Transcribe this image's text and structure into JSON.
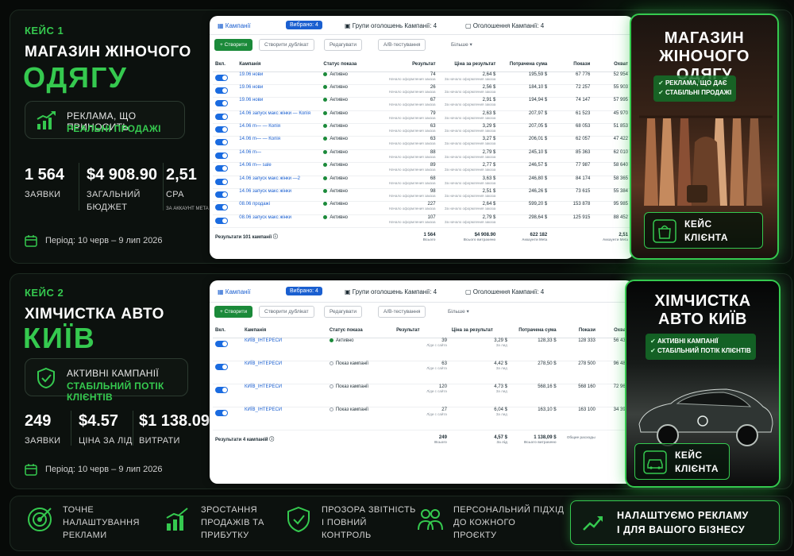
{
  "colors": {
    "accent": "#35c94f",
    "link": "#1a5fd0",
    "background": "#070a08"
  },
  "case1": {
    "label": "КЕЙС 1",
    "title": "МАГАЗИН ЖІНОЧОГО",
    "big": "ОДЯГУ",
    "pill_line1": "РЕКЛАМА, ЩО ПРИНОСИТЬ",
    "pill_line2": "РЕАЛЬНІ ПРОДАЖІ",
    "stats": [
      {
        "value": "1 564",
        "label": "ЗАЯВКИ"
      },
      {
        "value": "$4 908.90",
        "label": "ЗАГАЛЬНИЙ БЮДЖЕТ"
      },
      {
        "value": "2,51",
        "label": "CPA",
        "sub": "ЗА АККАУНТ META"
      }
    ],
    "period": "Період: 10 черв – 9 лип 2026"
  },
  "case2": {
    "label": "КЕЙС 2",
    "title": "ХІМЧИСТКА АВТО",
    "big": "КИЇВ",
    "pill_line1": "АКТИВНІ КАМПАНІЇ",
    "pill_line2": "СТАБІЛЬНИЙ ПОТІК КЛІЄНТІВ",
    "stats": [
      {
        "value": "249",
        "label": "ЗАЯВКИ"
      },
      {
        "value": "$4.57",
        "label": "ЦІНА ЗА ЛІД"
      },
      {
        "value": "$1 138.09",
        "label": "ВИТРАТИ"
      }
    ],
    "period": "Період: 10 черв – 9 лип 2026"
  },
  "table1": {
    "tab_campaigns": "Кампанії",
    "selected": "Вибрано: 4",
    "tab_adsets": "Групи оголошень Кампанії: 4",
    "tab_ads": "Оголошення Кампанії: 4",
    "btn_create": "+ Створити",
    "btn_duplicate": "Створити дублікат",
    "btn_edit": "Редагувати",
    "btn_ab": "A/B-тестування",
    "btn_more": "Більше",
    "headers": [
      "Вкл.",
      "Кампанія",
      "Статус показа",
      "Результат",
      "Ціна за результат",
      "Потрачена сума",
      "Покази",
      "Охват"
    ],
    "result_sub": "Начало оформления заказа",
    "cost_sub": "За начало оформления заказа",
    "rows": [
      {
        "name": "19.06 нови",
        "status": "Активно",
        "result": "74",
        "cost": "2,64 $",
        "spent": "195,59 $",
        "impr": "67 776",
        "reach": "52 954"
      },
      {
        "name": "19.06 нови",
        "status": "Активно",
        "result": "26",
        "cost": "2,56 $",
        "spent": "184,10 $",
        "impr": "72 257",
        "reach": "55 903"
      },
      {
        "name": "19.06 нови",
        "status": "Активно",
        "result": "67",
        "cost": "2,91 $",
        "spent": "194,94 $",
        "impr": "74 147",
        "reach": "57 995"
      },
      {
        "name": "14.06 запуск макс жінки — Копія",
        "status": "Активно",
        "result": "79",
        "cost": "2,63 $",
        "spent": "207,97 $",
        "impr": "61 523",
        "reach": "45 970"
      },
      {
        "name": "14.06 m— — Копія",
        "status": "Активно",
        "result": "63",
        "cost": "3,29 $",
        "spent": "207,05 $",
        "impr": "68 053",
        "reach": "51 853"
      },
      {
        "name": "14.06 m— — Копія",
        "status": "Активно",
        "result": "63",
        "cost": "3,27 $",
        "spent": "206,01 $",
        "impr": "62 057",
        "reach": "47 422"
      },
      {
        "name": "14.06 m—",
        "status": "Активно",
        "result": "88",
        "cost": "2,79 $",
        "spent": "245,10 $",
        "impr": "85 363",
        "reach": "62 010"
      },
      {
        "name": "14.06 m— sale",
        "status": "Активно",
        "result": "89",
        "cost": "2,77 $",
        "spent": "246,57 $",
        "impr": "77 987",
        "reach": "58 640"
      },
      {
        "name": "14.06 запуск макс жінки —2",
        "status": "Активно",
        "result": "68",
        "cost": "3,63 $",
        "spent": "246,80 $",
        "impr": "84 174",
        "reach": "58 365"
      },
      {
        "name": "14.06 запуск макс жінки",
        "status": "Активно",
        "result": "98",
        "cost": "2,51 $",
        "spent": "246,26 $",
        "impr": "73 615",
        "reach": "55 384"
      },
      {
        "name": "08.06 продажі",
        "status": "Активно",
        "result": "227",
        "cost": "2,64 $",
        "spent": "599,20 $",
        "impr": "153 878",
        "reach": "95 985"
      },
      {
        "name": "08.06 запуск макс жінки",
        "status": "Активно",
        "result": "107",
        "cost": "2,79 $",
        "spent": "298,64 $",
        "impr": "125 915",
        "reach": "88 452"
      }
    ],
    "total": {
      "label": "Результати 101 кампанії",
      "result": "1 564",
      "result_sub": "Всього",
      "cost": "$4 908.90",
      "cost_sub": "Всього витрачено",
      "spent": "622 182",
      "spent_sub": "Аккаунти Meta",
      "cpa": "2,51",
      "cpa_sub": "Аккаунти Meta"
    }
  },
  "table2": {
    "tab_campaigns": "Кампанії",
    "selected": "Вибрано: 4",
    "tab_adsets": "Групи оголошень Кампанії: 4",
    "tab_ads": "Оголошення Кампанії: 4",
    "btn_create": "+ Створити",
    "btn_duplicate": "Створити дублікат",
    "btn_edit": "Редагувати",
    "btn_ab": "A/B-тестування",
    "btn_more": "Більше",
    "headers": [
      "Вкл.",
      "Кампанія",
      "Статус показа",
      "Результат",
      "Ціна за результат",
      "Потрачена сума",
      "Покази",
      "Охват"
    ],
    "result_sub": "Ліди с сайта",
    "cost_sub": "За лид",
    "rows": [
      {
        "name": "КИЇВ_ІНТЕРЕСИ",
        "status": "Активно",
        "active": true,
        "result": "39",
        "cost": "3,29 $",
        "spent": "128,33 $",
        "impr": "128 333",
        "reach": "56 437"
      },
      {
        "name": "КИЇВ_ІНТЕРЕСИ",
        "status": "Показ кампанії",
        "active": false,
        "result": "63",
        "cost": "4,42 $",
        "spent": "278,50 $",
        "impr": "278 500",
        "reach": "96 489"
      },
      {
        "name": "КИЇВ_ІНТЕРЕСИ",
        "status": "Показ кампанії",
        "active": false,
        "result": "120",
        "cost": "4,73 $",
        "spent": "568,16 $",
        "impr": "568 160",
        "reach": "72 960"
      },
      {
        "name": "КИЇВ_ІНТЕРЕСИ",
        "status": "Показ кампанії",
        "active": false,
        "result": "27",
        "cost": "6,04 $",
        "spent": "163,10 $",
        "impr": "163 100",
        "reach": "34 390"
      }
    ],
    "total": {
      "label": "Результати 4 кампаній",
      "result": "249",
      "result_sub": "Всього",
      "cost": "4,57 $",
      "cost_sub": "За лід",
      "spent": "1 138,09 $",
      "spent_sub": "Всього витрачено",
      "impr_sub": "Общие расходы"
    }
  },
  "promo1": {
    "title_l1": "МАГАЗИН",
    "title_l2": "ЖІНОЧОГО ОДЯГУ",
    "tick1": "РЕКЛАМА, ЩО ДАЄ",
    "tick2": "СТАБІЛЬНІ ПРОДАЖІ",
    "cta_l1": "КЕЙС",
    "cta_l2": "КЛІЄНТА"
  },
  "promo2": {
    "title_l1": "ХІМЧИСТКА",
    "title_l2": "АВТО КИЇВ",
    "tick1": "АКТИВНІ КАМПАНІЇ",
    "tick2": "СТАБІЛЬНИЙ ПОТІК КЛІЄНТІВ",
    "cta_l1": "КЕЙС",
    "cta_l2": "КЛІЄНТА"
  },
  "footer": {
    "f1": [
      "ТОЧНЕ",
      "НАЛАШТУВАННЯ",
      "РЕКЛАМИ"
    ],
    "f2": [
      "ЗРОСТАННЯ",
      "ПРОДАЖІВ ТА",
      "ПРИБУТКУ"
    ],
    "f3": [
      "ПРОЗОРА ЗВІТНІСТЬ",
      "І ПОВНИЙ",
      "КОНТРОЛЬ"
    ],
    "f4": [
      "ПЕРСОНАЛЬНИЙ ПІДХІД",
      "ДО КОЖНОГО",
      "ПРОЄКТУ"
    ],
    "cta_l1": "НАЛАШТУЄМО РЕКЛАМУ",
    "cta_l2": "І ДЛЯ ВАШОГО БІЗНЕСУ"
  }
}
